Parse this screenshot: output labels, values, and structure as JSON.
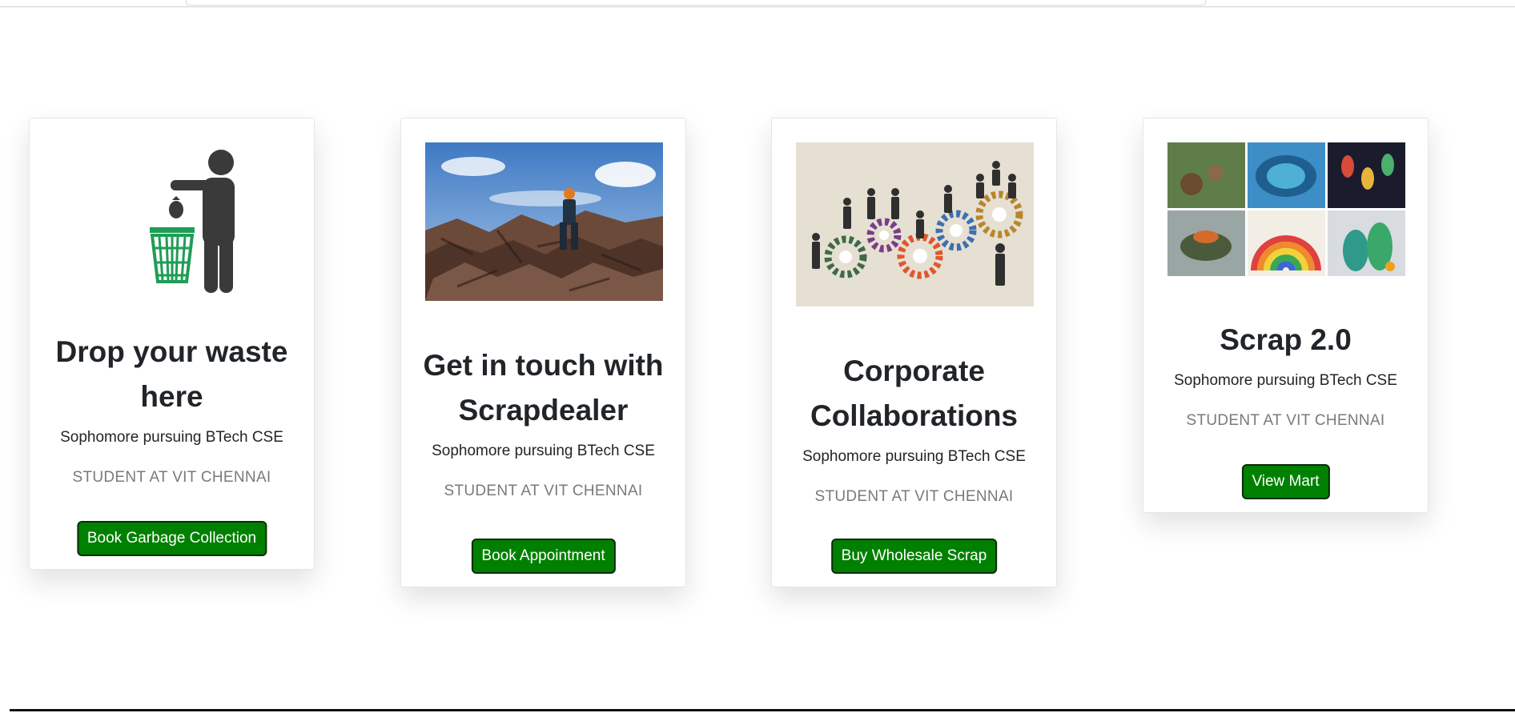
{
  "cards": [
    {
      "image": "waste-bin-person-icon",
      "title": "Drop your waste here",
      "text": "Sophomore pursuing BTech CSE",
      "subtitle": "STUDENT AT VIT CHENNAI",
      "button": "Book Garbage Collection"
    },
    {
      "image": "scrapyard-worker-photo",
      "title": "Get in touch with Scrapdealer",
      "text": "Sophomore pursuing BTech CSE",
      "subtitle": "STUDENT AT VIT CHENNAI",
      "button": "Book Appointment"
    },
    {
      "image": "business-gears-illustration",
      "title": "Corporate Collaborations",
      "text": "Sophomore pursuing BTech CSE",
      "subtitle": "STUDENT AT VIT CHENNAI",
      "button": "Buy Wholesale Scrap"
    },
    {
      "image": "upcycled-crafts-collage",
      "title": "Scrap 2.0",
      "text": "Sophomore pursuing BTech CSE",
      "subtitle": "STUDENT AT VIT CHENNAI",
      "button": "View Mart"
    }
  ],
  "colors": {
    "button_bg": "#008000",
    "button_border": "#0b2b0b",
    "title": "#212529",
    "muted": "#7a7a7a",
    "bin_green": "#1f9d55",
    "figure_dark": "#3a3a3a"
  }
}
